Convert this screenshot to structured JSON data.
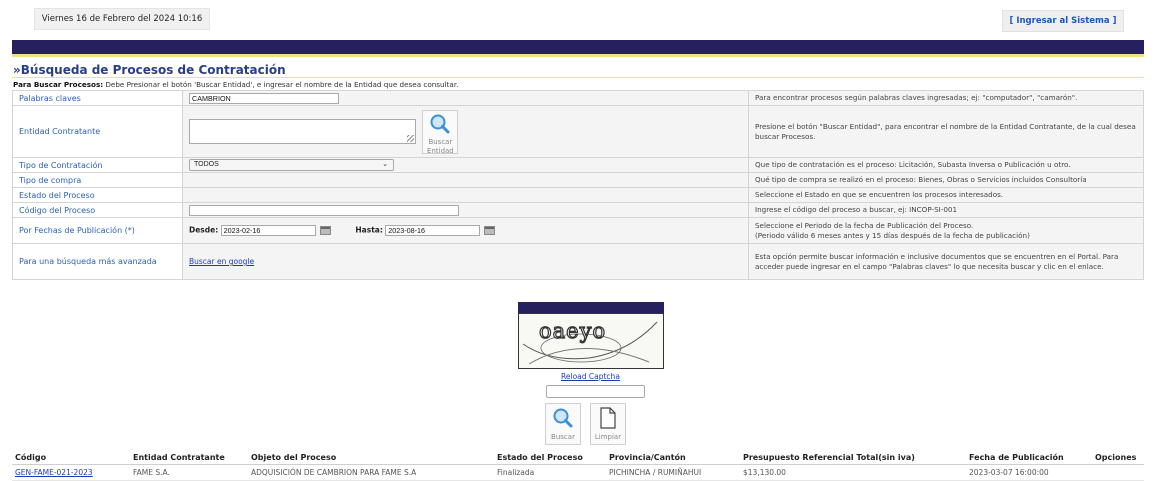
{
  "header": {
    "date": "Viernes 16 de Febrero del 2024 10:16",
    "login": "[ Ingresar al Sistema ]"
  },
  "section": {
    "title": "»Búsqueda de Procesos de Contratación",
    "instructions_bold": "Para Buscar Procesos:",
    "instructions_text": " Debe Presionar el botón 'Buscar Entidad', e ingresar el nombre de la Entidad que desea consultar."
  },
  "form": {
    "keywords": {
      "label": "Palabras claves",
      "value": "CAMBRION",
      "help": "Para encontrar procesos según palabras claves ingresadas; ej: \"computador\", \"camarón\"."
    },
    "entity": {
      "label": "Entidad Contratante",
      "button_line1": "Buscar",
      "button_line2": "Entidad",
      "help": "Presione el botón \"Buscar Entidad\", para encontrar el nombre de la Entidad Contratante, de la cual desea buscar Procesos."
    },
    "contract_type": {
      "label": "Tipo de Contratación",
      "value": "TODOS",
      "help": "Que tipo de contratación es el proceso: Licitación, Subasta Inversa o Publicación u otro."
    },
    "purchase_type": {
      "label": "Tipo de compra",
      "help": "Qué tipo de compra se realizó en el proceso: Bienes, Obras o Servicios incluidos Consultoría"
    },
    "process_state": {
      "label": "Estado del Proceso",
      "help": "Seleccione el Estado en que se encuentren los procesos interesados."
    },
    "process_code": {
      "label": "Código del Proceso",
      "help": "Ingrese el código del proceso a buscar, ej: INCOP-SI-001"
    },
    "dates": {
      "label": "Por Fechas de Publicación (*)",
      "from_label": "Desde:",
      "from_value": "2023-02-16",
      "to_label": "Hasta:",
      "to_value": "2023-08-16",
      "help_line1": "Seleccione el Periodo de la fecha de Publicación del Proceso.",
      "help_line2": "(Periodo válido 6 meses antes y 15 días después de la fecha de publicación)"
    },
    "advanced": {
      "label": "Para una búsqueda más avanzada",
      "link": "Buscar en google",
      "help": "Esta opción permite buscar información e inclusive documentos que se encuentren en el Portal. Para acceder puede ingresar en el campo \"Palabras claves\" lo que necesita buscar y clic en el enlace."
    }
  },
  "captcha": {
    "text": "oaeyo",
    "reload": "Reload Captcha",
    "search_button": "Buscar",
    "clear_button": "Limpiar"
  },
  "results": {
    "columns": [
      "Código",
      "Entidad Contratante",
      "Objeto del Proceso",
      "Estado del Proceso",
      "Provincia/Cantón",
      "Presupuesto Referencial Total(sin iva)",
      "Fecha de Publicación",
      "Opciones"
    ],
    "rows": [
      {
        "code": "GEN-FAME-021-2023",
        "entity": "FAME S.A.",
        "object": "ADQUISICIÓN DE CAMBRION PARA FAME S.A",
        "state": "Finalizada",
        "location": "PICHINCHA / RUMIÑAHUI",
        "budget": "$13,130.00",
        "date": "2023-03-07 16:00:00",
        "options": ""
      }
    ]
  },
  "colors": {
    "navy_bar": "#26215e",
    "accent_line": "#f2e27a",
    "label_blue": "#2a5fb0",
    "link_blue": "#1a3bb8"
  },
  "icons": {
    "entity_search": "magnifier-icon",
    "search": "magnifier-icon",
    "clear": "blank-document-icon",
    "calendar": "calendar-icon",
    "select": "chevron-down-icon"
  }
}
